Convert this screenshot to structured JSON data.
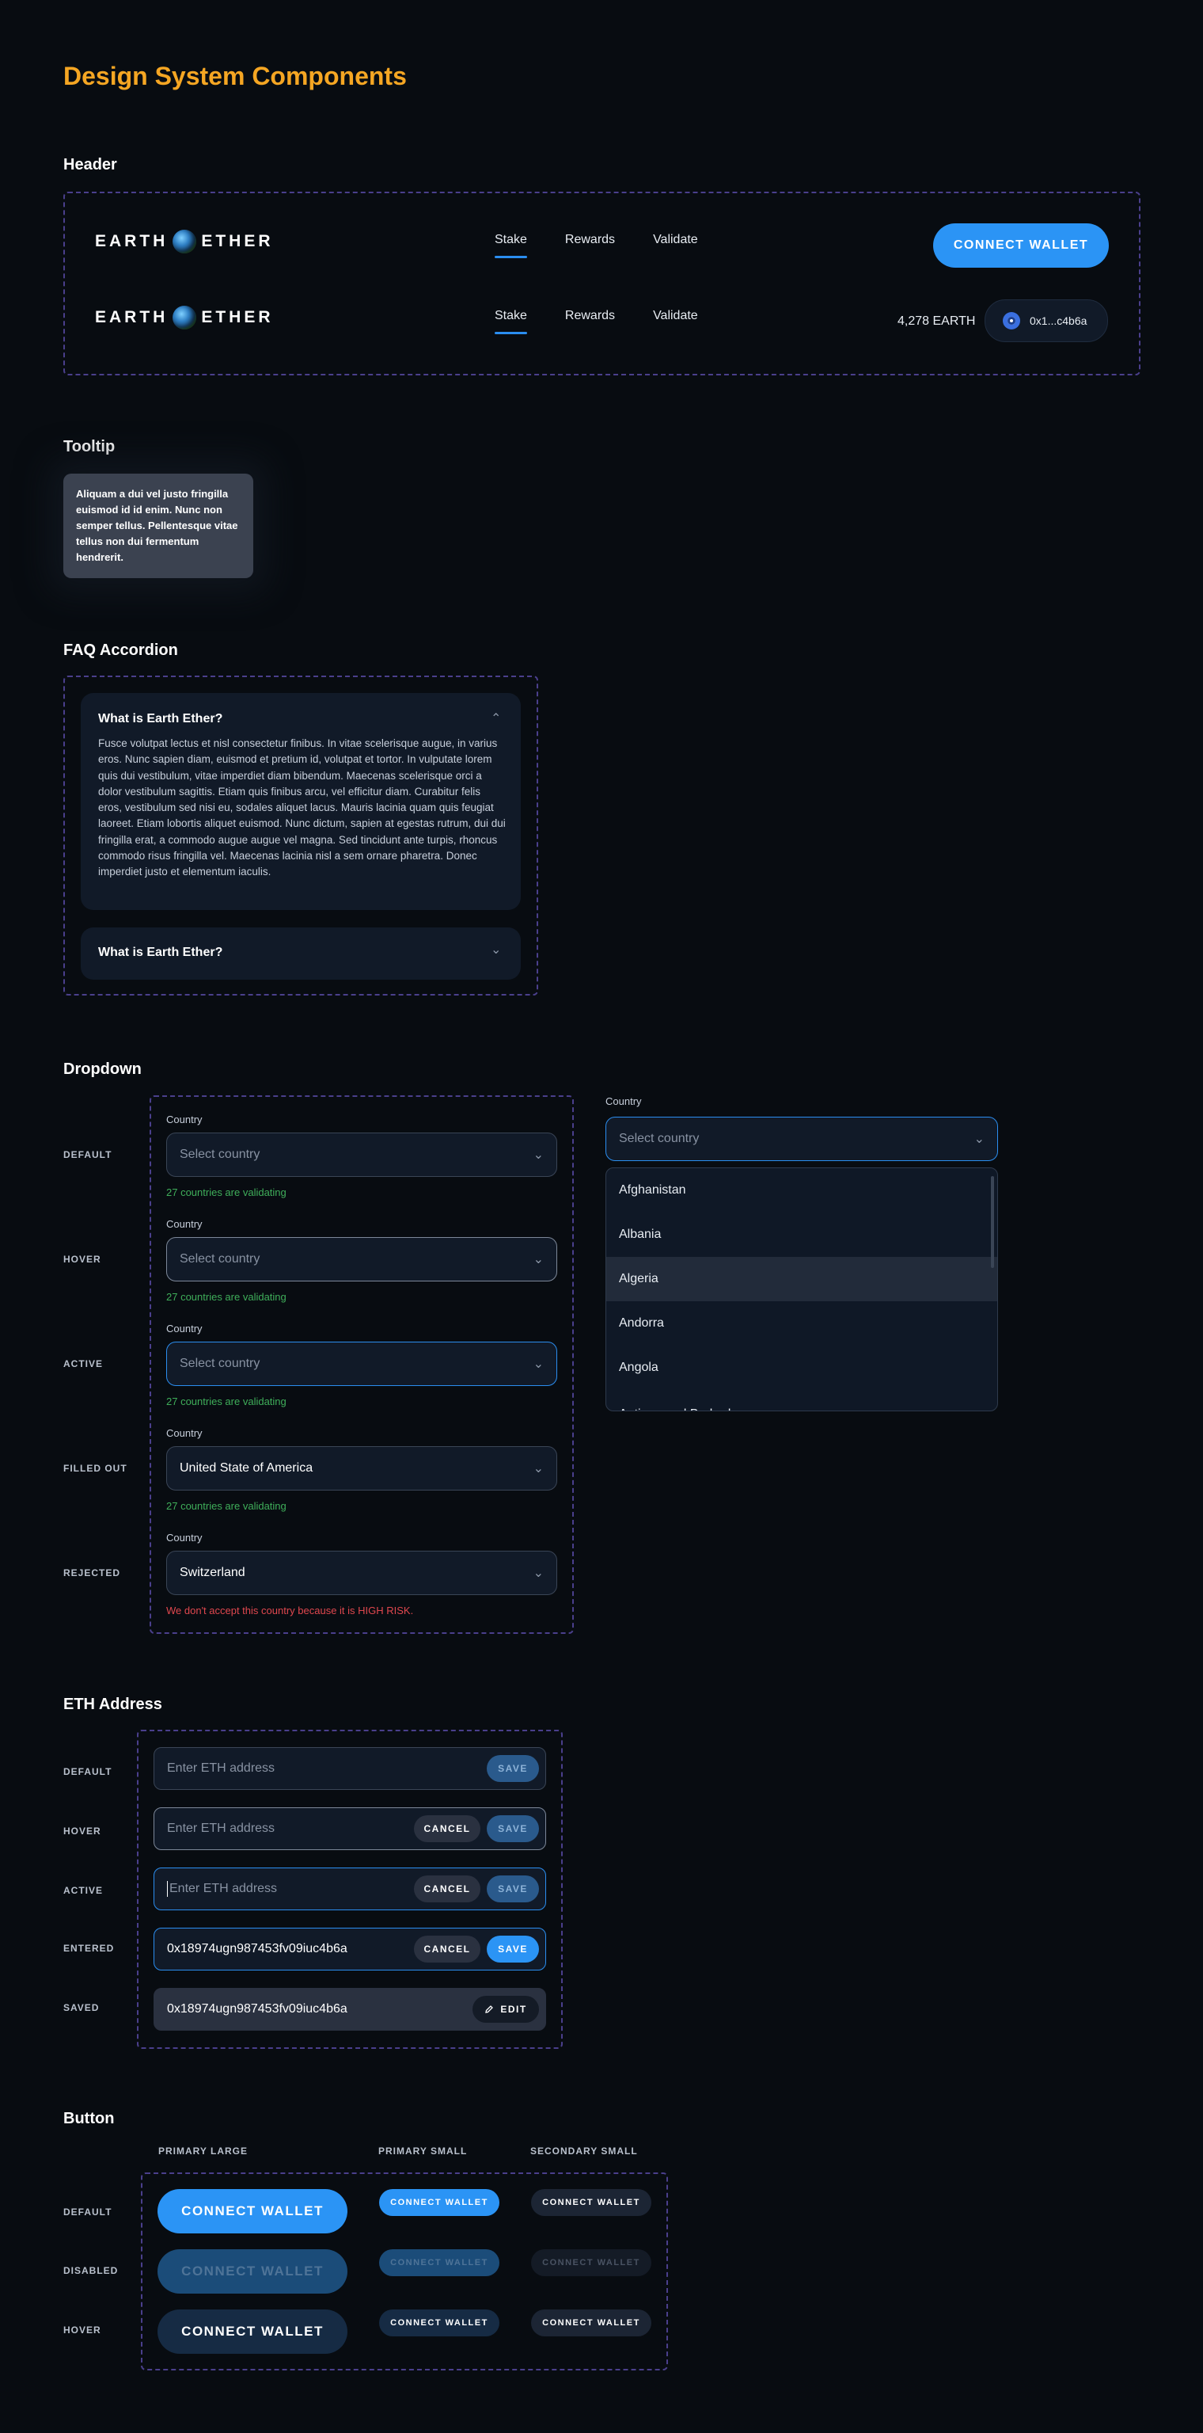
{
  "page": {
    "title": "Design System Components"
  },
  "header_section": {
    "title": "Header",
    "logo": {
      "left": "EARTH",
      "right": "ETHER"
    },
    "nav": [
      "Stake",
      "Rewards",
      "Validate"
    ],
    "connect_label": "CONNECT WALLET",
    "balance": "4,278 EARTH",
    "wallet_address": "0x1...c4b6a"
  },
  "tooltip_section": {
    "title": "Tooltip",
    "text": "Aliquam a dui vel justo fringilla euismod id id enim. Nunc non semper tellus. Pellentesque vitae tellus non dui fermentum hendrerit."
  },
  "faq_section": {
    "title": "FAQ Accordion",
    "items": [
      {
        "question": "What is Earth Ether?",
        "answer": "Fusce volutpat lectus et nisl consectetur finibus. In vitae scelerisque augue, in varius eros. Nunc sapien diam, euismod et pretium id, volutpat et tortor. In vulputate lorem quis dui vestibulum, vitae imperdiet diam bibendum. Maecenas scelerisque orci a dolor vestibulum sagittis. Etiam quis finibus arcu, vel efficitur diam. Curabitur felis eros, vestibulum sed nisi eu, sodales aliquet lacus. Mauris lacinia quam quis feugiat laoreet. Etiam lobortis aliquet euismod. Nunc dictum, sapien at egestas rutrum, dui dui fringilla erat, a commodo augue augue vel magna. Sed tincidunt ante turpis, rhoncus commodo risus fringilla vel. Maecenas lacinia nisl a sem ornare pharetra. Donec imperdiet justo et elementum iaculis.",
        "expanded": true
      },
      {
        "question": "What is Earth Ether?",
        "expanded": false
      }
    ]
  },
  "dropdown_section": {
    "title": "Dropdown",
    "field_label": "Country",
    "states": [
      {
        "state": "DEFAULT",
        "value": "Select country",
        "helper": "27 countries are validating"
      },
      {
        "state": "HOVER",
        "value": "Select country",
        "helper": "27 countries are validating"
      },
      {
        "state": "ACTIVE",
        "value": "Select country",
        "helper": "27 countries are validating"
      },
      {
        "state": "FILLED OUT",
        "value": "United State of America",
        "helper": "27 countries are validating"
      },
      {
        "state": "REJECTED",
        "value": "Switzerland",
        "helper": "We don't accept this country because it is HIGH RISK."
      }
    ],
    "open": {
      "label": "Country",
      "placeholder": "Select country",
      "options": [
        "Afghanistan",
        "Albania",
        "Algeria",
        "Andorra",
        "Angola",
        "Antigua and Barbuda"
      ],
      "highlighted": "Algeria"
    }
  },
  "eth_section": {
    "title": "ETH Address",
    "placeholder": "Enter ETH address",
    "address": "0x18974ugn987453fv09iuc4b6a",
    "states": [
      "DEFAULT",
      "HOVER",
      "ACTIVE",
      "ENTERED",
      "SAVED"
    ],
    "cancel_label": "CANCEL",
    "save_label": "SAVE",
    "edit_label": "EDIT"
  },
  "button_section": {
    "title": "Button",
    "columns": [
      "PRIMARY LARGE",
      "PRIMARY SMALL",
      "SECONDARY SMALL"
    ],
    "rows": [
      "DEFAULT",
      "DISABLED",
      "HOVER"
    ],
    "label": "CONNECT WALLET"
  }
}
